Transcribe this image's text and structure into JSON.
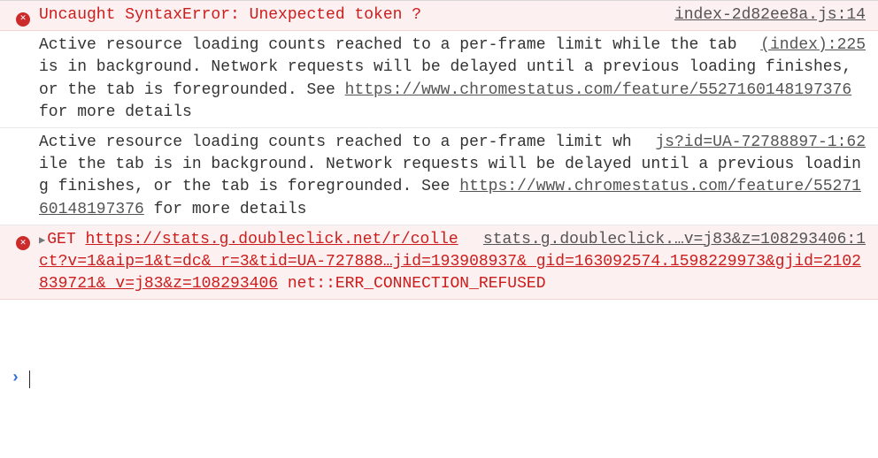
{
  "colors": {
    "error_bg": "#fdf0f0",
    "error_fg": "#cc1c1c",
    "link": "#545454",
    "prompt": "#2a6fd6"
  },
  "rows": [
    {
      "type": "error",
      "source": "index-2d82ee8a.js:14",
      "message": "Uncaught SyntaxError: Unexpected token ?"
    },
    {
      "type": "log",
      "source": "(index):225",
      "message_pre": "Active resource loading counts reached to a per-frame limit while the tab is in background. Network requests will be delayed until a previous loading finishes, or the tab is foregrounded. See ",
      "message_link": "https://www.chromestatus.com/feature/5527160148197376",
      "message_post": " for more details"
    },
    {
      "type": "log",
      "source": "js?id=UA-72788897-1:62",
      "message_pre": "Active resource loading counts reached to a per-frame limit while the tab is in background. Network requests will be delayed until a previous loading finishes, or the tab is foregrounded. See ",
      "message_link": "https://www.chromestatus.com/feature/5527160148197376",
      "message_post": " for more details"
    },
    {
      "type": "error",
      "has_disclosure": true,
      "source": "stats.g.doubleclick.…v=j83&z=108293406:1",
      "method": "GET",
      "url": "https://stats.g.doubleclick.net/r/collect?v=1&aip=1&t=dc&_r=3&tid=UA-727888…jid=193908937&_gid=163092574.1598229973&gjid=2102839721&_v=j83&z=108293406",
      "net_error": "net::ERR_CONNECTION_REFUSED"
    }
  ],
  "prompt": {
    "symbol": "›",
    "value": ""
  }
}
